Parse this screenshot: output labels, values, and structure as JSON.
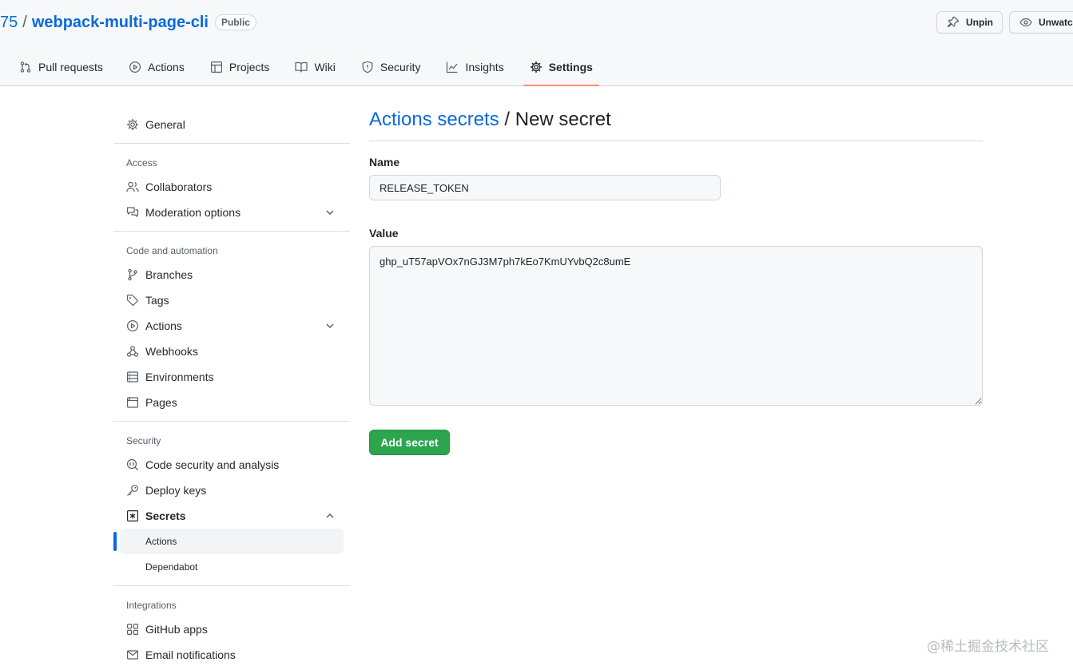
{
  "repo": {
    "owner_fragment": "75",
    "separator": "/",
    "name": "webpack-multi-page-cli",
    "visibility": "Public",
    "unpin_label": "Unpin",
    "unwatch_label": "Unwatch"
  },
  "tabs": [
    {
      "label": "Pull requests",
      "icon": "git-pull-request-icon"
    },
    {
      "label": "Actions",
      "icon": "play-icon"
    },
    {
      "label": "Projects",
      "icon": "table-icon"
    },
    {
      "label": "Wiki",
      "icon": "book-icon"
    },
    {
      "label": "Security",
      "icon": "shield-icon"
    },
    {
      "label": "Insights",
      "icon": "graph-icon"
    },
    {
      "label": "Settings",
      "icon": "gear-icon",
      "selected": true
    }
  ],
  "sidebar": {
    "general": "General",
    "groups": {
      "access": "Access",
      "code": "Code and automation",
      "security": "Security",
      "integrations": "Integrations"
    },
    "items": {
      "collaborators": "Collaborators",
      "moderation": "Moderation options",
      "branches": "Branches",
      "tags": "Tags",
      "actions": "Actions",
      "webhooks": "Webhooks",
      "environments": "Environments",
      "pages": "Pages",
      "code_security": "Code security and analysis",
      "deploy_keys": "Deploy keys",
      "secrets": "Secrets",
      "secrets_actions": "Actions",
      "secrets_dependabot": "Dependabot",
      "github_apps": "GitHub apps",
      "email_notifications": "Email notifications"
    }
  },
  "main": {
    "breadcrumb_link": "Actions secrets",
    "breadcrumb_rest": " / New secret",
    "name_label": "Name",
    "name_value": "RELEASE_TOKEN",
    "value_label": "Value",
    "value_value": "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",
    "submit_label": "Add secret"
  },
  "watermark": "@稀土掘金技术社区",
  "colors": {
    "accent": "#0969da",
    "tab_underline": "#fd8c73",
    "primary_button": "#2da44e"
  }
}
